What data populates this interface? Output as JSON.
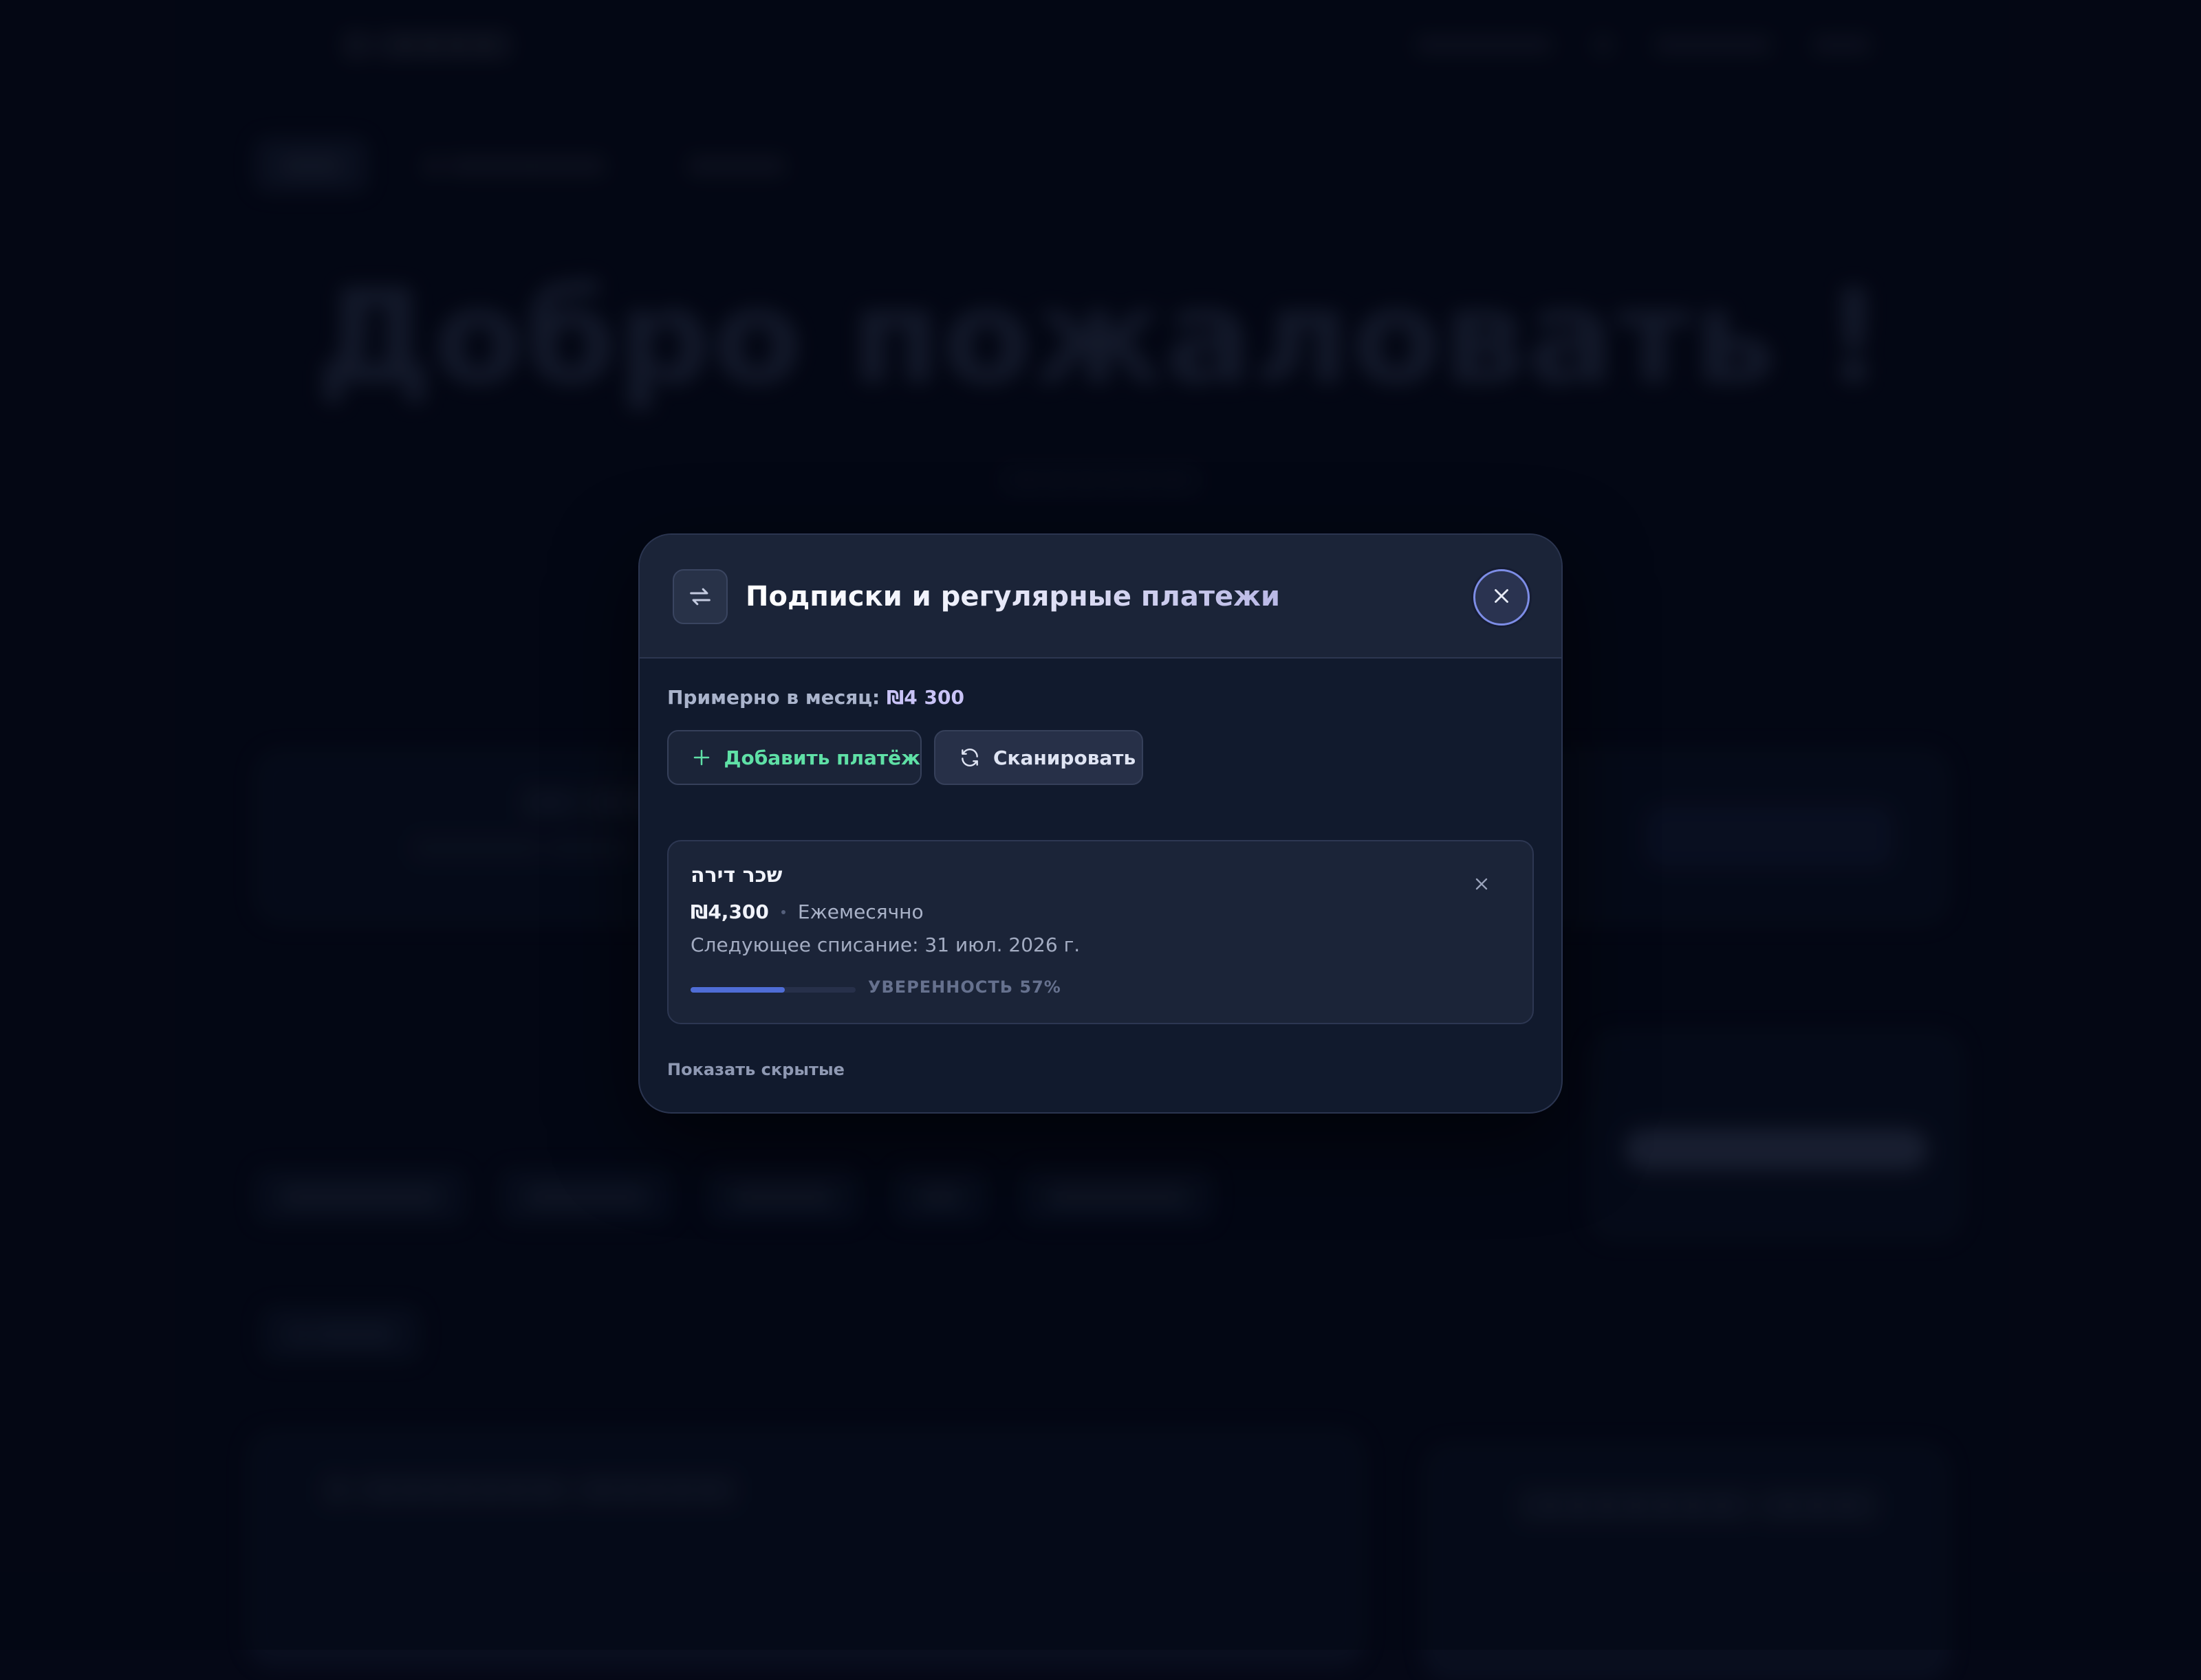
{
  "modal": {
    "title": "Подписки и регулярные платежи",
    "icon": "repeat-icon",
    "close_icon": "close-icon",
    "summary_label": "Примерно в месяц:",
    "summary_amount": "₪4 300",
    "add_button": "Добавить платёж",
    "scan_button": "Сканировать",
    "subscriptions": [
      {
        "name": "שכר דירה",
        "amount": "₪4,300",
        "frequency": "Ежемесячно",
        "next_charge": "Следующее списание: 31 июл. 2026 г.",
        "confidence_label": "УВЕРЕННОСТЬ 57%",
        "confidence": 0.57
      }
    ],
    "show_hidden": "Показать скрытые"
  },
  "background": {
    "hero_title": "Добро пожаловать !"
  },
  "colors": {
    "accent_green": "#5fe0a6",
    "accent_blue": "#4f6dd6",
    "close_ring": "#7d8de6"
  }
}
